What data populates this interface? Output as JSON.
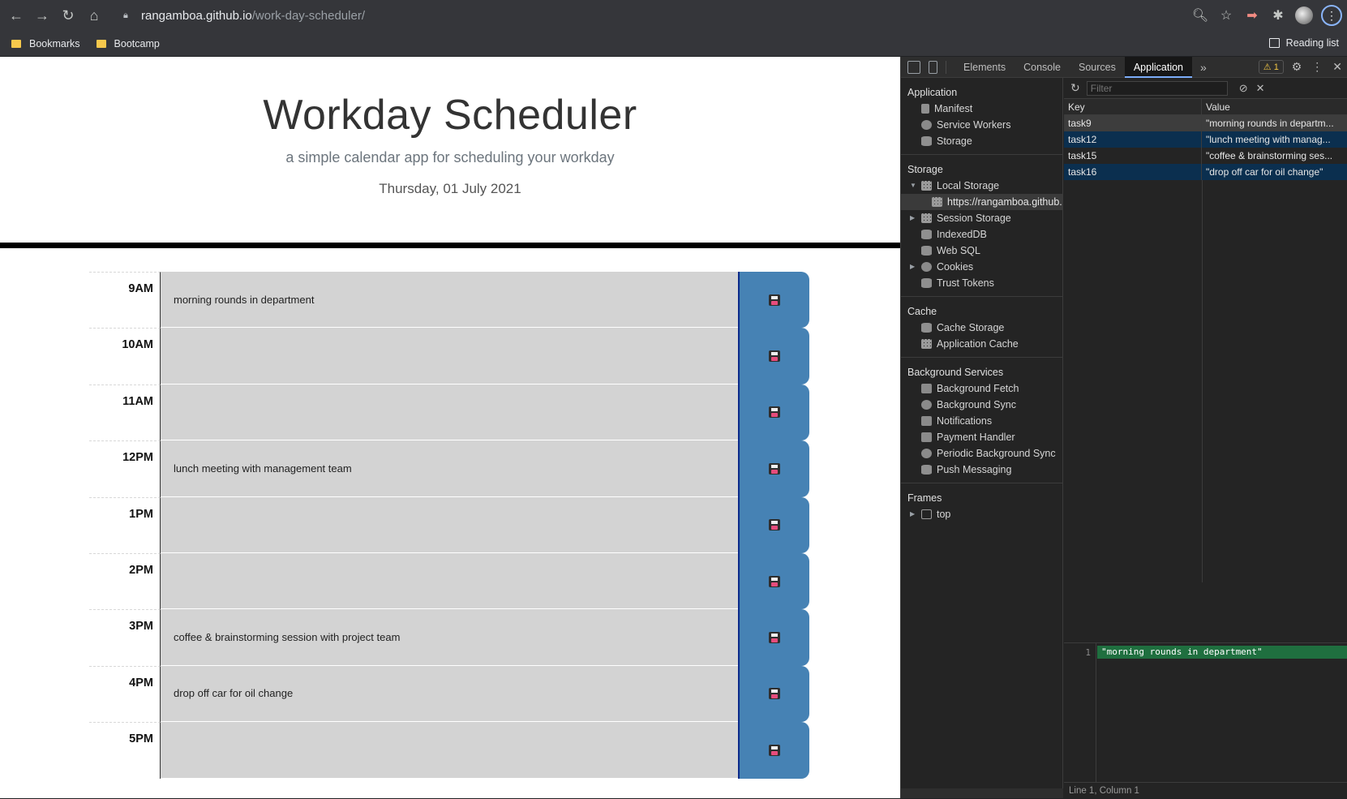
{
  "browser": {
    "url_host": "rangamboa.github.io",
    "url_path": "/work-day-scheduler/",
    "bookmarks": [
      "Bookmarks",
      "Bootcamp"
    ],
    "reading_list": "Reading list"
  },
  "page": {
    "title": "Workday Scheduler",
    "subtitle": "a simple calendar app for scheduling your workday",
    "current_day": "Thursday, 01 July 2021",
    "rows": [
      {
        "hour": "9AM",
        "task": "morning rounds in department"
      },
      {
        "hour": "10AM",
        "task": ""
      },
      {
        "hour": "11AM",
        "task": ""
      },
      {
        "hour": "12PM",
        "task": "lunch meeting with management team"
      },
      {
        "hour": "1PM",
        "task": ""
      },
      {
        "hour": "2PM",
        "task": ""
      },
      {
        "hour": "3PM",
        "task": "coffee & brainstorming session with project team"
      },
      {
        "hour": "4PM",
        "task": "drop off car for oil change"
      },
      {
        "hour": "5PM",
        "task": ""
      }
    ]
  },
  "devtools": {
    "tabs": [
      "Elements",
      "Console",
      "Sources",
      "Application"
    ],
    "active_tab": "Application",
    "warning_count": "1",
    "sections": {
      "application": {
        "title": "Application",
        "items": [
          "Manifest",
          "Service Workers",
          "Storage"
        ]
      },
      "storage": {
        "title": "Storage",
        "items": [
          "Local Storage",
          "https://rangamboa.github.io",
          "Session Storage",
          "IndexedDB",
          "Web SQL",
          "Cookies",
          "Trust Tokens"
        ]
      },
      "cache": {
        "title": "Cache",
        "items": [
          "Cache Storage",
          "Application Cache"
        ]
      },
      "background": {
        "title": "Background Services",
        "items": [
          "Background Fetch",
          "Background Sync",
          "Notifications",
          "Payment Handler",
          "Periodic Background Sync",
          "Push Messaging"
        ]
      },
      "frames": {
        "title": "Frames",
        "items": [
          "top"
        ]
      }
    },
    "filter_placeholder": "Filter",
    "table": {
      "headers": {
        "key": "Key",
        "value": "Value"
      },
      "rows": [
        {
          "key": "task9",
          "value": "\"morning rounds in departm..."
        },
        {
          "key": "task12",
          "value": "\"lunch meeting with manag..."
        },
        {
          "key": "task15",
          "value": "\"coffee & brainstorming ses..."
        },
        {
          "key": "task16",
          "value": "\"drop off car for oil change\""
        }
      ]
    },
    "preview": {
      "line_number": "1",
      "text": "\"morning rounds in department\""
    },
    "status": "Line 1, Column 1"
  }
}
